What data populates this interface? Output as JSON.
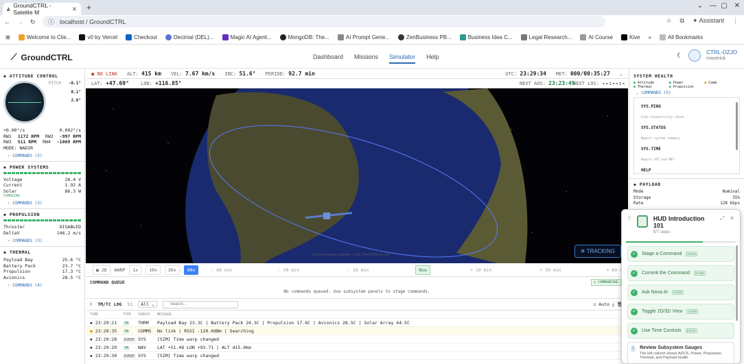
{
  "browser": {
    "tab_title": "GroundCTRL - Satelite M",
    "url": "localhost / GroundCTRL",
    "assistant": "Assistant",
    "bookmarks": [
      "Welcome to Clie...",
      "v0 by Vercel",
      "Checkout",
      "Decimal (DEL)...",
      "Magic AI Agent...",
      "MongoDB: The...",
      "AI Prompt Gene...",
      "ZenBusiness PB...",
      "Business Idea C...",
      "Legal Research...",
      "AI Course",
      "Kive"
    ],
    "all_bookmarks": "All Bookmarks"
  },
  "app": {
    "logo": "GroundCTRL",
    "nav": [
      "Dashboard",
      "Missions",
      "Simulator",
      "Help"
    ],
    "active_nav": "Simulator",
    "user_id": "CTRL-OZJO",
    "user_name": "maverick"
  },
  "attitude": {
    "title": "ATTITUDE CONTROL",
    "pitch_label": "PITCH",
    "pitch": "-0.1°",
    "roll": "0.1°",
    "yaw": "2.6°",
    "rate1": "+0.00°/s",
    "rate2": "0.002°/s",
    "rw1_label": "RW1",
    "rw1": "1172 RPM",
    "rw2_label": "RW2",
    "rw2": "-997 RPM",
    "rw3_label": "RW3",
    "rw3": "511 RPM",
    "rw4_label": "RW4",
    "rw4": "-1069 RPM",
    "mode": "MODE: NADIR",
    "commands": "COMMANDS (5)"
  },
  "power": {
    "title": "POWER SYSTEMS",
    "voltage_label": "Voltage",
    "voltage": "28.4 V",
    "current_label": "Current",
    "current": "1.92 A",
    "solar_label": "Solar",
    "solar": "86.3 W",
    "charging": "CHARGING",
    "commands": "COMMANDS (3)"
  },
  "propulsion": {
    "title": "PROPULSION",
    "thruster_label": "Thruster",
    "thruster": "DISABLED",
    "deltav_label": "DeltaV",
    "deltav": "146.2 m/s",
    "commands": "COMMANDS (3)"
  },
  "thermal": {
    "title": "THERMAL",
    "rows": [
      [
        "Payload Bay",
        "25.6 °C"
      ],
      [
        "Battery Pack",
        "23.7 °C"
      ],
      [
        "Propulsion",
        "17.3 °C"
      ],
      [
        "Avionics",
        "28.5 °C"
      ]
    ],
    "commands": "COMMANDS (4)"
  },
  "telemetry": {
    "link": "NO LINK",
    "alt_label": "ALT:",
    "alt": "415 km",
    "vel_label": "VEL:",
    "vel": "7.67 km/s",
    "inc_label": "INC:",
    "inc": "51.6°",
    "period_label": "PERIOD:",
    "period": "92.7 min",
    "utc_label": "UTC:",
    "utc": "23:29:34",
    "met_label": "MET:",
    "met": "000/00:35:27",
    "lat_label": "LAT:",
    "lat": "+47.69°",
    "lon_label": "LON:",
    "lon": "+116.85°",
    "next_aos_label": "NEXT AOS:",
    "next_aos": "23:23:49",
    "next_los_label": "NEXT LOS:",
    "next_los": "--:--:--"
  },
  "viewport": {
    "tracking": "TRACKING",
    "note": "Camera tracking satellite • Click TRACKING to exit"
  },
  "timeline": {
    "mode": "2D",
    "warp_label": "WARP",
    "warps": [
      "1x",
      "10x",
      "30x",
      "60x"
    ],
    "active_warp": "60x",
    "marks": [
      "- 60 min",
      "- 30 min",
      "- 10 min",
      "Now",
      "+ 10 min",
      "+ 30 min",
      "+ 60 min"
    ]
  },
  "command_queue": {
    "title": "COMMAND QUEUE",
    "empty": "No commands queued. Use subsystem panels to stage commands.",
    "button": "COMMANDING"
  },
  "tmtc": {
    "title": "TM/TC LOG",
    "count": "51",
    "filter": "All",
    "search_placeholder": "Search...",
    "auto": "Auto",
    "headers": [
      "TIME",
      "TYPE",
      "SUBSYS",
      "MESSAGE"
    ],
    "rows": [
      [
        "23:29:21",
        "TM",
        "THRM",
        "Payload Bay 23.3C | Battery Pack 24.3C | Propulsion 17.6C | Avionics 28.5C | Solar Array 44.5C"
      ],
      [
        "23:29:35",
        "TM",
        "COMMS",
        "No link | RSSI -120.0dBm | Searching"
      ],
      [
        "23:29:28",
        "EVENT",
        "SYS",
        "[SIM] Time warp changed"
      ],
      [
        "23:29:29",
        "TM",
        "NAV",
        "LAT +51.48 LON +93.71 | ALT 415.0km"
      ],
      [
        "23:29:30",
        "EVENT",
        "SYS",
        "[SIM] Time warp changed"
      ]
    ]
  },
  "system_health": {
    "title": "SYSTEM HEALTH",
    "items": [
      "Attitude",
      "Power",
      "Comm",
      "Thermal",
      "Propulsion"
    ],
    "commands": "COMMANDS (5)",
    "cmds": [
      [
        "SYS.PING",
        "Echo connectivity check"
      ],
      [
        "SYS.STATUS",
        "Report system summary"
      ],
      [
        "SYS.TIME",
        "Report UTC and MET"
      ],
      [
        "HELP",
        ""
      ]
    ]
  },
  "payload": {
    "title": "PAYLOAD",
    "mode_label": "Mode",
    "mode": "Nominal",
    "storage_label": "Storage",
    "storage": "35%",
    "rate_label": "Rate",
    "rate": "128 kbps"
  },
  "hud": {
    "title": "HUD Introduction 101",
    "steps_text": "6/7 steps",
    "progress": 0.7,
    "steps": [
      "Stage a Command",
      "Commit the Command",
      "Ask Nova AI",
      "Toggle 2D/3D View",
      "Use Time Controls"
    ],
    "done": "DONE",
    "review_title": "Review Subsystem Gauges",
    "review_desc": "The left column shows ADCS, Power, Propulsion, Thermal, and Payload health"
  }
}
